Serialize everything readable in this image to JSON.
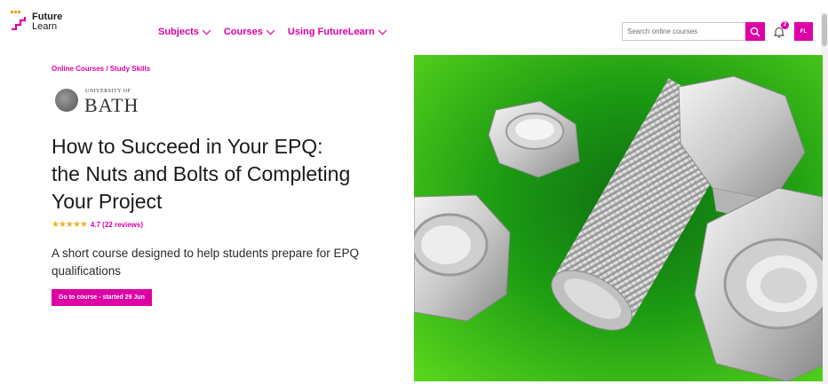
{
  "logo": {
    "line1": "Future",
    "line2": "Learn"
  },
  "nav": [
    {
      "label": "Subjects"
    },
    {
      "label": "Courses"
    },
    {
      "label": "Using FutureLearn"
    }
  ],
  "search": {
    "placeholder": "Search online courses"
  },
  "notifications": {
    "count": "2"
  },
  "user": {
    "initials": "FL"
  },
  "breadcrumb": {
    "item1": "Online Courses",
    "separator": " / ",
    "item2": "Study Skills"
  },
  "partner": {
    "small": "UNIVERSITY OF",
    "big": "BATH"
  },
  "course": {
    "title": "How to Succeed in Your EPQ: the Nuts and Bolts of Completing Your Project",
    "stars": "★★★★★",
    "rating": "4.7 (22 reviews)",
    "rating_fraction": 0.94,
    "description": "A short course designed to help students prepare for EPQ qualifications",
    "cta": "Go to course - started 29 Jun"
  },
  "colors": {
    "brand": "#de00a5",
    "star": "#f0b020",
    "hero_green": "#1f9a0c"
  },
  "icons": {
    "search": "search-icon",
    "bell": "bell-icon",
    "chevron": "chevron-down-icon"
  }
}
